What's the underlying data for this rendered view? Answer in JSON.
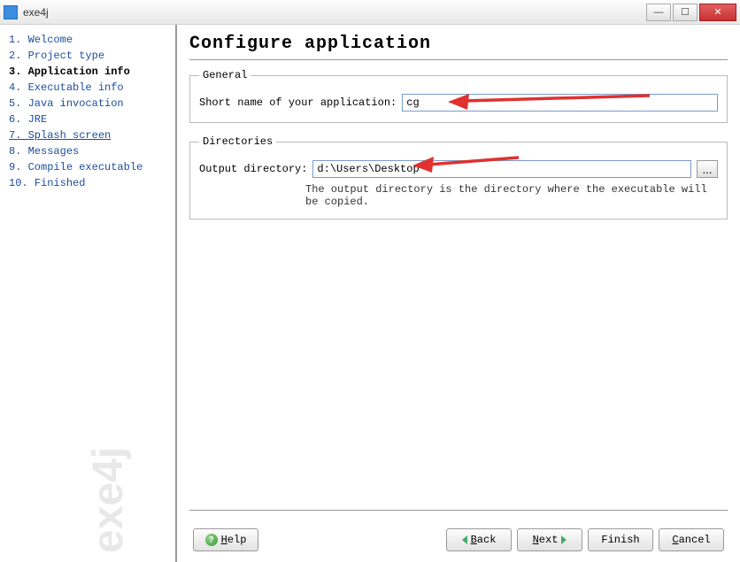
{
  "window": {
    "title": "exe4j"
  },
  "sidebar": {
    "watermark": "exe4j",
    "steps": [
      {
        "num": "1.",
        "label": "Welcome"
      },
      {
        "num": "2.",
        "label": "Project type"
      },
      {
        "num": "3.",
        "label": "Application info"
      },
      {
        "num": "4.",
        "label": "Executable info"
      },
      {
        "num": "5.",
        "label": "Java invocation"
      },
      {
        "num": "6.",
        "label": "JRE"
      },
      {
        "num": "7.",
        "label": "Splash screen"
      },
      {
        "num": "8.",
        "label": "Messages"
      },
      {
        "num": "9.",
        "label": "Compile executable"
      },
      {
        "num": "10.",
        "label": "Finished"
      }
    ]
  },
  "page": {
    "title": "Configure application"
  },
  "general": {
    "legend": "General",
    "short_name_label": "Short name of your application:",
    "short_name_value": "cg"
  },
  "directories": {
    "legend": "Directories",
    "output_label": "Output directory:",
    "output_value": "d:\\Users\\Desktop",
    "browse_label": "...",
    "hint": "The output directory is the directory where the executable will be copied."
  },
  "footer": {
    "help": "Help",
    "back": "Back",
    "next": "Next",
    "finish": "Finish",
    "cancel": "Cancel"
  }
}
